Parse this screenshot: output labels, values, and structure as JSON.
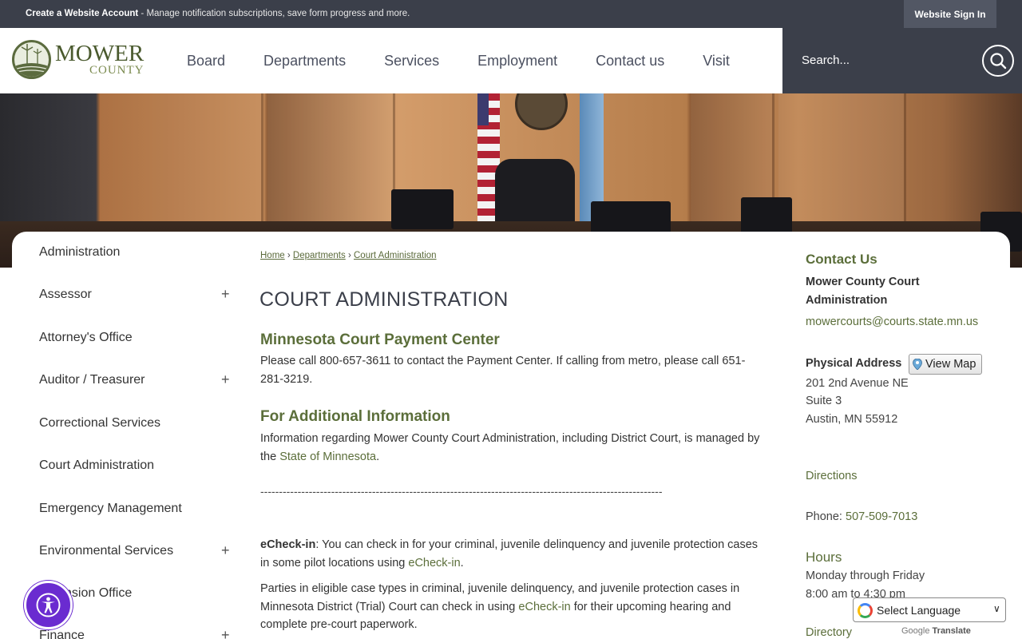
{
  "topbar": {
    "promo_bold": "Create a Website Account",
    "promo_text": " - Manage notification subscriptions, save form progress and more.",
    "signin_label": "Website Sign In"
  },
  "logo": {
    "line1": "MOWER",
    "line2": "COUNTY"
  },
  "nav": [
    "Board",
    "Departments",
    "Services",
    "Employment",
    "Contact us",
    "Visit"
  ],
  "search": {
    "placeholder": "Search..."
  },
  "sidebar": {
    "items": [
      {
        "label": "Administration",
        "expandable": false
      },
      {
        "label": "Assessor",
        "expandable": true
      },
      {
        "label": "Attorney's Office",
        "expandable": false
      },
      {
        "label": "Auditor / Treasurer",
        "expandable": true
      },
      {
        "label": "Correctional Services",
        "expandable": false
      },
      {
        "label": "Court Administration",
        "expandable": false
      },
      {
        "label": "Emergency Management",
        "expandable": false
      },
      {
        "label": "Environmental Services",
        "expandable": true
      },
      {
        "label": "Extension Office",
        "expandable": false
      },
      {
        "label": "Finance",
        "expandable": true
      }
    ],
    "plus": "+"
  },
  "breadcrumb": {
    "home": "Home",
    "sep": " › ",
    "departments": "Departments",
    "current": "Court Administration"
  },
  "page": {
    "title": "COURT ADMINISTRATION",
    "section1_heading": "Minnesota Court Payment Center",
    "section1_text": "Please call 800-657-3611 to contact the Payment Center. If calling from metro, please call 651-281-3219.",
    "section2_heading": "For Additional Information",
    "section2_text": "Information regarding Mower County Court Administration, including District Court, is managed by the ",
    "section2_link": "State of Minnesota",
    "section2_end": ".",
    "divider": "------------------------------------------------------------------------------------------------------------",
    "echeckin_bold": "eCheck-in",
    "echeckin_text": ": You can check in for your criminal, juvenile delinquency and juvenile protection cases in some pilot locations using ",
    "echeckin_link": "eCheck-in",
    "echeckin_end": ".",
    "parties_text": "Parties in eligible case types in criminal, juvenile delinquency, and juvenile protection cases in Minnesota District (Trial) Court can check in using ",
    "parties_link": "eCheck-in",
    "parties_end": " for their upcoming hearing and complete pre-court paperwork."
  },
  "contact": {
    "heading": "Contact Us",
    "org_name": "Mower County Court Administration",
    "email": "mowercourts@courts.state.mn.us",
    "address_label": "Physical Address",
    "view_map": "View Map",
    "address_line1": "201 2nd Avenue NE",
    "address_line2": "Suite 3",
    "address_line3": "Austin, MN 55912",
    "directions": "Directions",
    "phone_label": "Phone: ",
    "phone": "507-509-7013",
    "hours_heading": "Hours",
    "hours_days": "Monday through Friday",
    "hours_time": "8:00 am to 4:30 pm",
    "directory": "Directory"
  },
  "translate": {
    "label": "Select Language",
    "powered_google": "Google",
    "powered_translate": "Translate"
  },
  "icons": {
    "search": "search-icon",
    "a11y": "accessibility-icon",
    "map_pin": "map-pin-icon"
  },
  "colors": {
    "dark_bar": "#3b3f4a",
    "accent_green": "#5b6e3a",
    "a11y_purple": "#6a2bd0"
  }
}
